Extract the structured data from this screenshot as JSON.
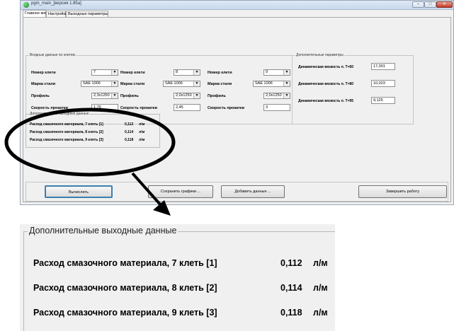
{
  "window": {
    "title": "pgm_main_[версия 1.85a]",
    "controls": [
      "–",
      "□",
      "✕"
    ]
  },
  "tabs": [
    "Главное меню",
    "Настройки",
    "Выходные параметры"
  ],
  "input_group": {
    "title": "Входные данные по клетям",
    "stands": [
      {
        "stand_label": "Номер клети",
        "stand_value": "7",
        "steel_label": "Марка стали",
        "steel_value": "SAE 1006",
        "profile_label": "Профиль",
        "profile_value": "2,3х1250",
        "speed_label": "Скорость прокатки",
        "speed_value": "1,79"
      },
      {
        "stand_label": "Номер клети",
        "stand_value": "8",
        "steel_label": "Марка стали",
        "steel_value": "SAE 1006",
        "profile_label": "Профиль",
        "profile_value": "2,0х1250",
        "speed_label": "Скорость прокатки",
        "speed_value": "2,45"
      },
      {
        "stand_label": "Номер клети",
        "stand_value": "9",
        "steel_label": "Марка стали",
        "steel_value": "SAE 1006",
        "profile_label": "Профиль",
        "profile_value": "2,0х1250",
        "speed_label": "Скорость прокатки",
        "speed_value": "3"
      }
    ]
  },
  "extra_params": {
    "title": "Дополнительные параметры",
    "items": [
      {
        "label": "Динамическая вязкость п. T=60",
        "value": "17,001"
      },
      {
        "label": "Динамическая вязкость п. T=80",
        "value": "10,023"
      },
      {
        "label": "Динамическая вязкость п. T=95",
        "value": "9,125"
      }
    ]
  },
  "output_group": {
    "title": "Дополнительные выходные данные",
    "rows": [
      {
        "label": "Расход смазочного материала, 7 клеть [1]",
        "value": "0,112",
        "unit": "л/м"
      },
      {
        "label": "Расход смазочного материала, 8 клеть [2]",
        "value": "0,114",
        "unit": "л/м"
      },
      {
        "label": "Расход смазочного материала, 9 клеть [3]",
        "value": "0,118",
        "unit": "л/м"
      }
    ]
  },
  "buttons": {
    "compute": "Вычислить",
    "save_plots": "Сохранить графики ...",
    "add_data": "Добавить данные ...",
    "finish": "Завершить работу"
  },
  "zoom": {
    "title": "Дополнительные выходные данные",
    "rows": [
      {
        "label": "Расход смазочного материала, 7 клеть [1]",
        "value": "0,112",
        "unit": "л/м"
      },
      {
        "label": "Расход смазочного материала, 8 клеть [2]",
        "value": "0,114",
        "unit": "л/м"
      },
      {
        "label": "Расход смазочного материала, 9 клеть [3]",
        "value": "0,118",
        "unit": "л/м"
      }
    ]
  }
}
